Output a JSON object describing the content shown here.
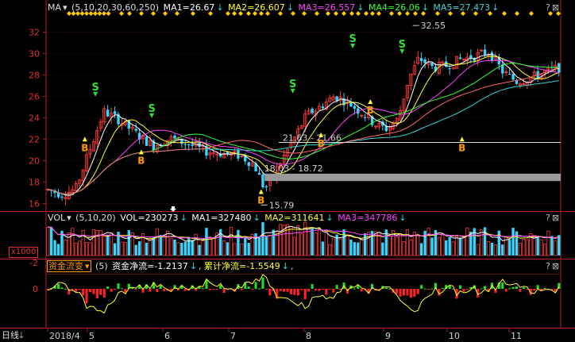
{
  "main_header": {
    "ind_name": "MA",
    "params": "(5,10,20,30,60,250)",
    "ma1": "MA1=26.67",
    "ma2": "MA2=26.607",
    "ma3": "MA3=26.557",
    "ma4": "MA4=26.06",
    "ma5": "MA5=27.473"
  },
  "vol_header": {
    "ind_name": "VOL",
    "params": "(5,10,20)",
    "vol": "VOL=230273",
    "ma1": "MA1=327480",
    "ma2": "MA2=311641",
    "ma3": "MA3=347786"
  },
  "fund_header": {
    "ind_name": "资金流变",
    "params": "(5)",
    "net": "资金净流=-1.2137",
    "cum": "累计净流=-1.5549"
  },
  "vol_unit": "x1000",
  "period_label": "日线",
  "colors": {
    "up": "#ff3b3b",
    "down": "#36d6ff",
    "ma1": "#ffffff",
    "ma2": "#ffff33",
    "ma3": "#ff44ff",
    "ma4": "#33ff33",
    "ma5": "#33d6d6",
    "ma6": "#ff6666"
  },
  "chart_data": [
    {
      "type": "candlestick",
      "y_ticks": [
        16,
        18,
        20,
        22,
        24,
        26,
        28,
        30,
        32
      ],
      "ylim": [
        15.3,
        33.3
      ],
      "x_labels": [
        "2018/4",
        "5",
        "6",
        "7",
        "8",
        "9",
        "10",
        "11"
      ],
      "annotations": [
        {
          "text": "32.55",
          "price": 32.55
        },
        {
          "text": "21.63 - 21.66",
          "price": 21.64
        },
        {
          "text": "18.03 - 18.72",
          "price": 18.4
        },
        {
          "text": "15.79",
          "price": 15.79
        }
      ],
      "signals": [
        {
          "type": "S",
          "price": 26.5
        },
        {
          "type": "B",
          "price": 21.5
        },
        {
          "type": "S",
          "price": 24.5
        },
        {
          "type": "B",
          "price": 20.3
        },
        {
          "type": "B",
          "price": 16.6
        },
        {
          "type": "S",
          "price": 26.8
        },
        {
          "type": "B",
          "price": 21.9
        },
        {
          "type": "S",
          "price": 31.0
        },
        {
          "type": "B",
          "price": 25.0
        },
        {
          "type": "S",
          "price": 30.5
        },
        {
          "type": "B",
          "price": 21.5
        }
      ]
    },
    {
      "type": "bar",
      "name": "VOL"
    },
    {
      "type": "bar",
      "name": "资金流变",
      "y_ticks": [
        0,
        -2
      ]
    }
  ]
}
